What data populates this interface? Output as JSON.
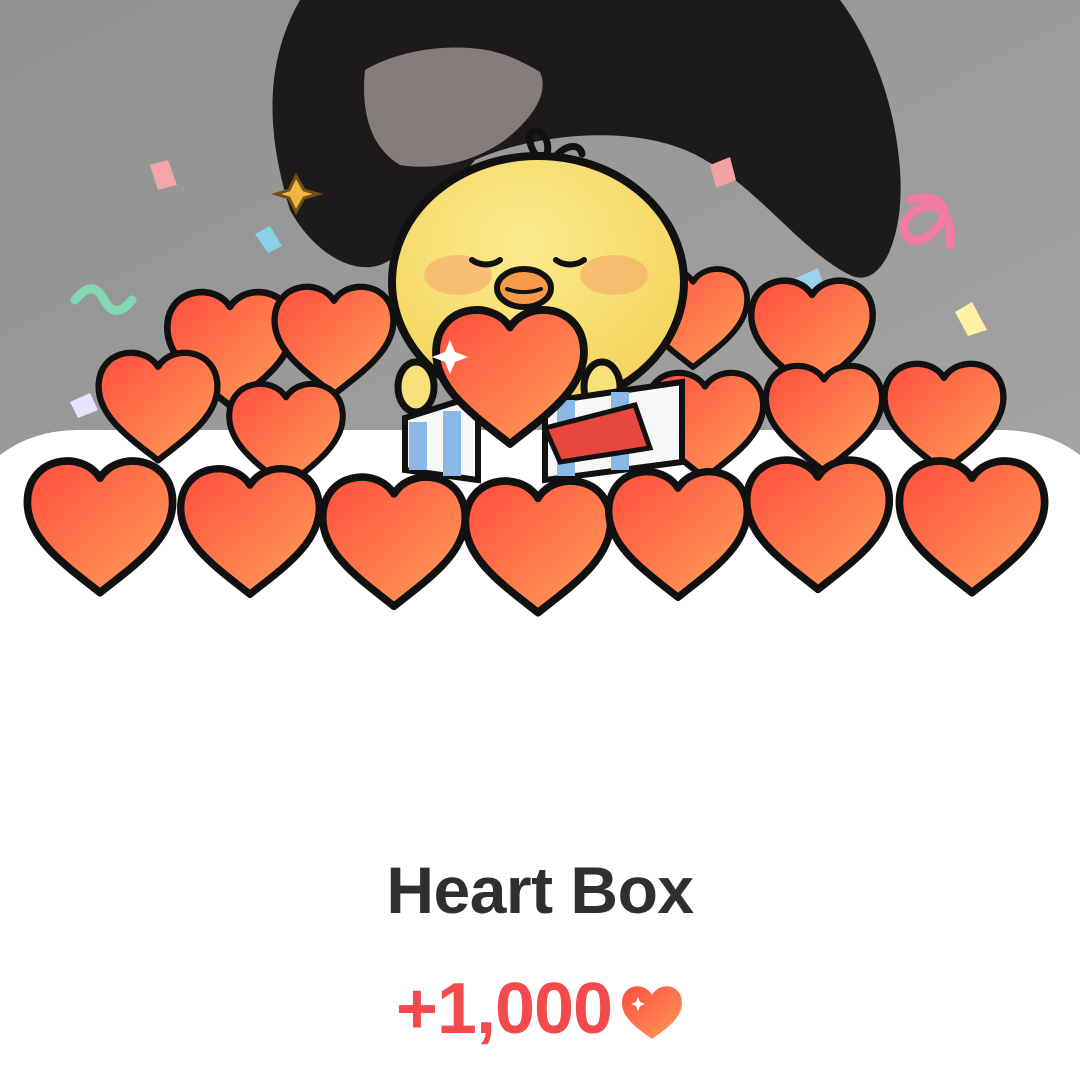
{
  "modal": {
    "title": "Heart Box",
    "reward_amount": "+1,000",
    "reward_icon": "heart-icon"
  },
  "colors": {
    "heart_top": "#ff4f3f",
    "heart_bottom": "#ff9a57",
    "chick": "#f7df72",
    "reward_text": "#f24a4d",
    "title_text": "#2f2f31",
    "background": "#ffffff"
  }
}
